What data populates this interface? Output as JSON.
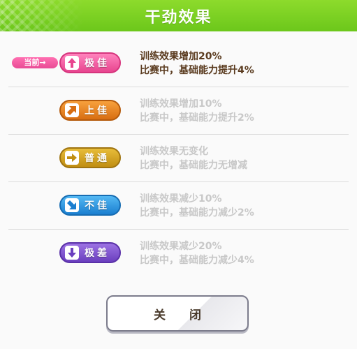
{
  "dialog": {
    "title": "干劲效果",
    "current_tag": "当前→",
    "close_label": "关 闭",
    "colors": {
      "header_green": "#7acf22",
      "active_text": "#5a3b1f",
      "inactive_text": "#c8c8c8"
    }
  },
  "levels": [
    {
      "label": "极佳",
      "arrow": "up-arrow-icon",
      "color": "#e8458f",
      "line1": "训练效果增加20%",
      "line2": "比赛中，基础能力提升4%",
      "current": true
    },
    {
      "label": "上佳",
      "arrow": "up-right-arrow-icon",
      "color": "#d86e12",
      "line1": "训练效果增加10%",
      "line2": "比赛中，基础能力提升2%",
      "current": false
    },
    {
      "label": "普通",
      "arrow": "right-arrow-icon",
      "color": "#c08e12",
      "line1": "训练效果无变化",
      "line2": "比赛中，基础能力无增减",
      "current": false
    },
    {
      "label": "不佳",
      "arrow": "down-right-arrow-icon",
      "color": "#1b7fd0",
      "line1": "训练效果减少10%",
      "line2": "比赛中，基础能力减少2%",
      "current": false
    },
    {
      "label": "极差",
      "arrow": "down-arrow-icon",
      "color": "#6b3fbf",
      "line1": "训练效果减少20%",
      "line2": "比赛中，基础能力减少4%",
      "current": false
    }
  ]
}
